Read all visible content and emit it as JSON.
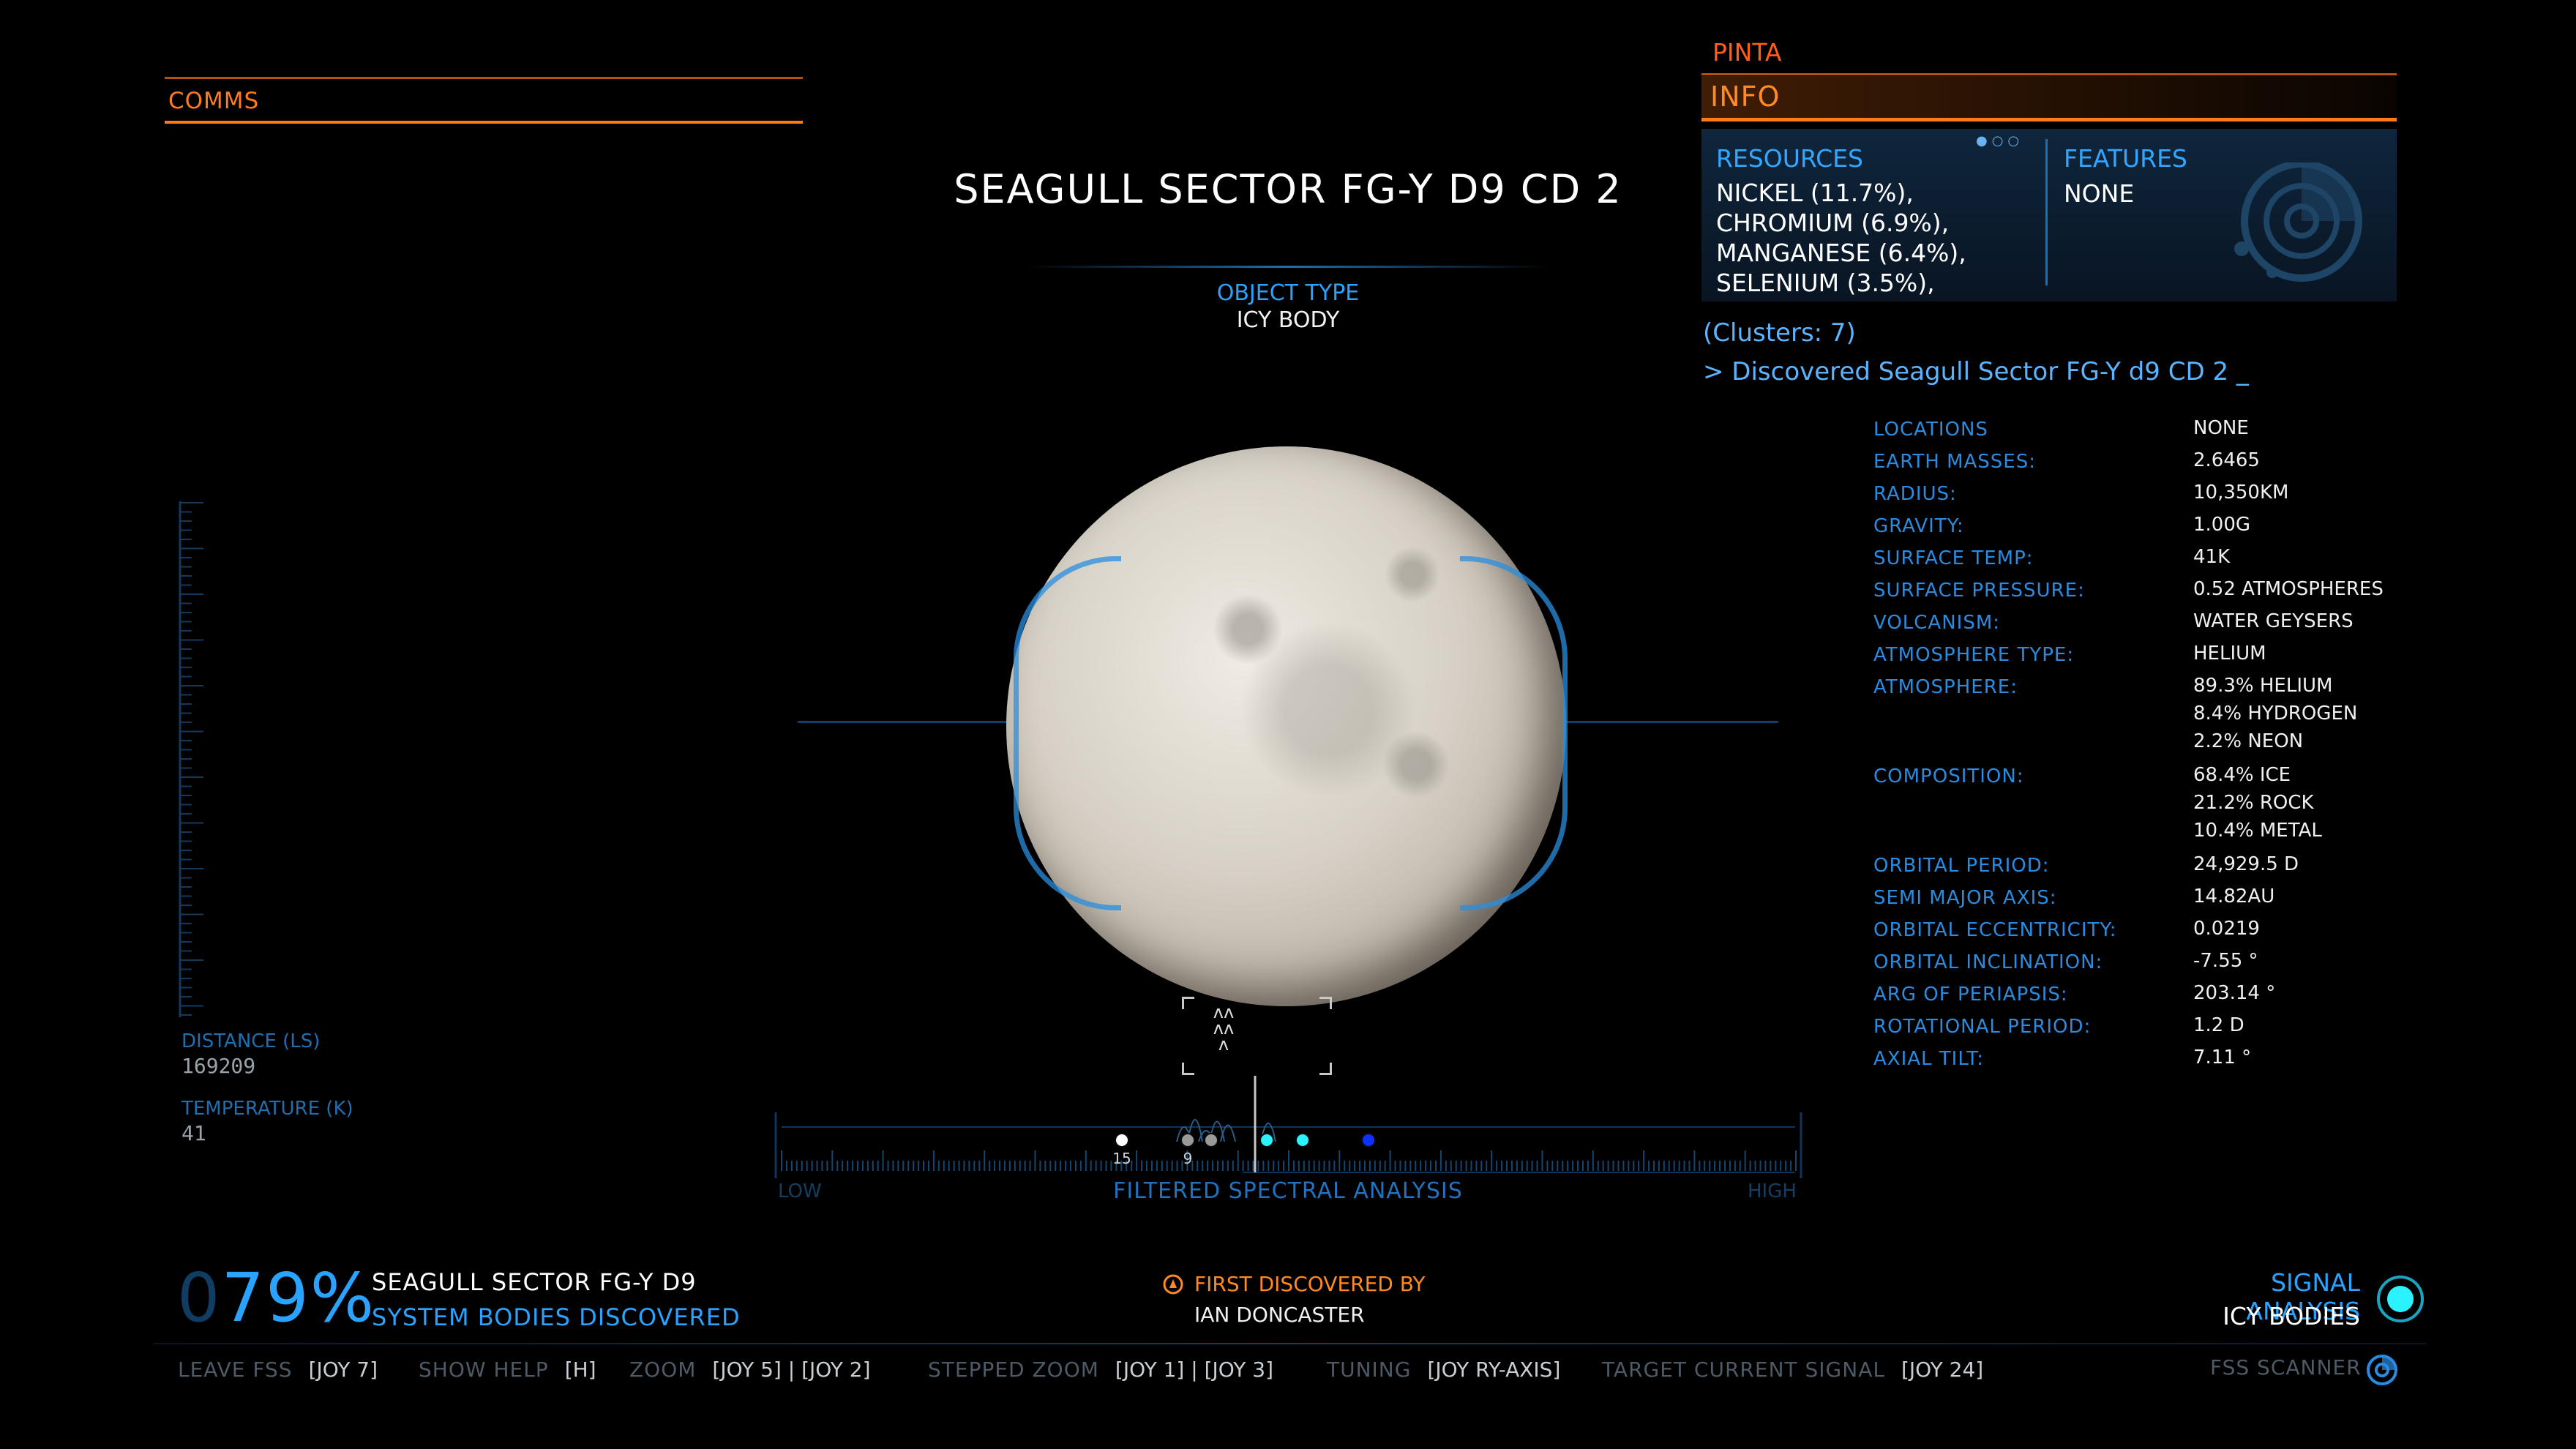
{
  "comms": {
    "label": "COMMS"
  },
  "body": {
    "title": "SEAGULL SECTOR FG-Y D9 CD 2",
    "object_type_label": "OBJECT TYPE",
    "object_type": "ICY BODY"
  },
  "left_gauges": {
    "distance_label": "DISTANCE (LS)",
    "distance_value": "169209",
    "temperature_label": "TEMPERATURE (K)",
    "temperature_value": "41"
  },
  "spectral": {
    "title": "FILTERED SPECTRAL ANALYSIS",
    "low_label": "LOW",
    "high_label": "HIGH",
    "markers": [
      {
        "label": "15",
        "color": "#ffffff"
      },
      {
        "label": "9",
        "color": "#9a9a9a"
      },
      {
        "label": "",
        "color": "#9a9a9a"
      },
      {
        "label": "",
        "color": "#2af2ff"
      },
      {
        "label": "",
        "color": "#2af2ff"
      },
      {
        "label": "",
        "color": "#1030ff"
      }
    ]
  },
  "info_panel": {
    "ship_name": "PINTA",
    "tab_label": "INFO",
    "resources_label": "RESOURCES",
    "resources": [
      "NICKEL (11.7%),",
      "CHROMIUM (6.9%),",
      "MANGANESE (6.4%),",
      "SELENIUM (3.5%),"
    ],
    "features_label": "FEATURES",
    "features_value": "NONE",
    "clusters": "(Clusters: 7)",
    "discovered": "> Discovered Seagull Sector FG-Y d9 CD 2 _"
  },
  "stats": [
    {
      "label": "LOCATIONS",
      "value": "NONE"
    },
    {
      "label": "EARTH MASSES:",
      "value": "2.6465"
    },
    {
      "label": "RADIUS:",
      "value": "10,350KM"
    },
    {
      "label": "GRAVITY:",
      "value": "1.00G"
    },
    {
      "label": "SURFACE TEMP:",
      "value": "41K"
    },
    {
      "label": "SURFACE PRESSURE:",
      "value": "0.52 ATMOSPHERES"
    },
    {
      "label": "VOLCANISM:",
      "value": "WATER GEYSERS"
    },
    {
      "label": "ATMOSPHERE TYPE:",
      "value": "HELIUM"
    },
    {
      "label": "ATMOSPHERE:",
      "value": "89.3% HELIUM\n8.4% HYDROGEN\n2.2% NEON"
    },
    {
      "label": "COMPOSITION:",
      "value": "68.4% ICE\n21.2% ROCK\n10.4% METAL"
    },
    {
      "label": "ORBITAL PERIOD:",
      "value": "24,929.5 D"
    },
    {
      "label": "SEMI MAJOR AXIS:",
      "value": "14.82AU"
    },
    {
      "label": "ORBITAL ECCENTRICITY:",
      "value": "0.0219"
    },
    {
      "label": "ORBITAL INCLINATION:",
      "value": "-7.55 °"
    },
    {
      "label": "ARG OF PERIAPSIS:",
      "value": "203.14 °"
    },
    {
      "label": "ROTATIONAL PERIOD:",
      "value": "1.2 D"
    },
    {
      "label": "AXIAL TILT:",
      "value": "7.11 °"
    }
  ],
  "discovery": {
    "percent_leading": "0",
    "percent": "79%",
    "system_name": "SEAGULL SECTOR FG-Y D9",
    "system_sub": "SYSTEM BODIES DISCOVERED",
    "first_discovered_label": "FIRST DISCOVERED BY",
    "first_discovered_name": "IAN DONCASTER"
  },
  "signal": {
    "label": "SIGNAL ANALYSIS",
    "value": "ICY BODIES"
  },
  "keybinds": [
    {
      "label": "LEAVE FSS",
      "keys": "[JOY 7]"
    },
    {
      "label": "SHOW HELP",
      "keys": "[H]"
    },
    {
      "label": "ZOOM",
      "keys": "[JOY 5] | [JOY 2]"
    },
    {
      "label": "STEPPED ZOOM",
      "keys": "[JOY 1] | [JOY 3]"
    },
    {
      "label": "TUNING",
      "keys": "[JOY RY-AXIS]"
    },
    {
      "label": "TARGET CURRENT SIGNAL",
      "keys": "[JOY 24]"
    }
  ],
  "fss_label": "FSS SCANNER",
  "colors": {
    "accent_orange": "#ff7a1a",
    "accent_blue": "#2aa3ff",
    "signal_cyan": "#2af2ff"
  }
}
